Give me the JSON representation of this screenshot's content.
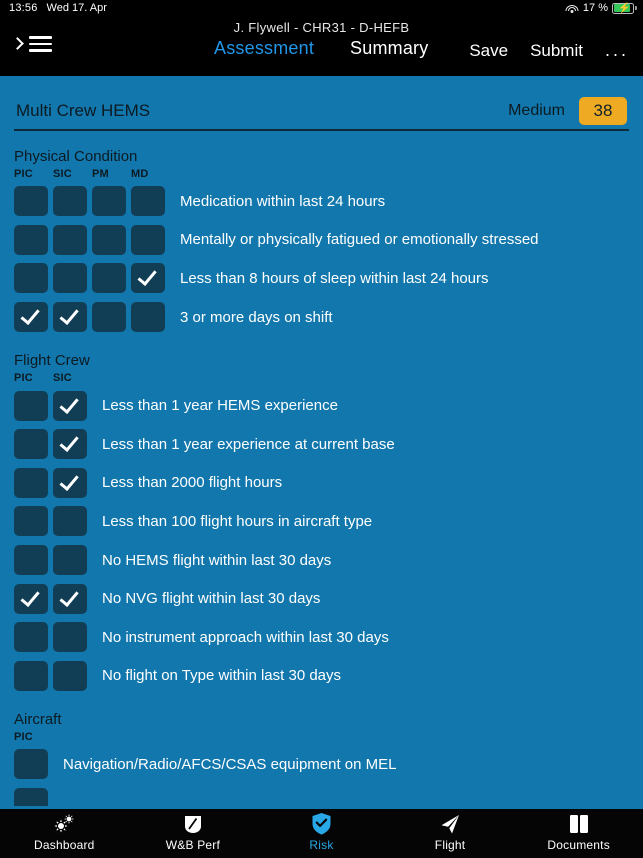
{
  "statusbar": {
    "time": "13:56",
    "date": "Wed 17. Apr",
    "wifi_icon": "wifi-icon",
    "battery_percent": "17 %",
    "battery_icon": "battery-charging-icon"
  },
  "navbar": {
    "crew_line": "J. Flywell  -  CHR31  -  D-HEFB",
    "menu_icon": "hamburger-icon",
    "expand_icon": "chevron-right-icon",
    "tabs": [
      {
        "label": "Assessment",
        "active": true
      },
      {
        "label": "Summary",
        "active": false
      }
    ],
    "actions": [
      {
        "label": "Save"
      },
      {
        "label": "Submit"
      },
      {
        "label": "..."
      }
    ]
  },
  "header": {
    "title": "Multi Crew HEMS",
    "risk_level": "Medium",
    "risk_score": "38",
    "risk_badge_color": "#eeaa22"
  },
  "sections": [
    {
      "title": "Physical Condition",
      "columns": [
        "PIC",
        "SIC",
        "PM",
        "MD"
      ],
      "rows": [
        {
          "label": "Medication within last 24 hours",
          "checks": [
            false,
            false,
            false,
            false
          ]
        },
        {
          "label": "Mentally or physically fatigued or emotionally stressed",
          "checks": [
            false,
            false,
            false,
            false
          ]
        },
        {
          "label": "Less than 8 hours of sleep within last 24 hours",
          "checks": [
            false,
            false,
            false,
            true
          ]
        },
        {
          "label": "3 or more days on shift",
          "checks": [
            true,
            true,
            false,
            false
          ]
        }
      ]
    },
    {
      "title": "Flight Crew",
      "columns": [
        "PIC",
        "SIC"
      ],
      "rows": [
        {
          "label": "Less than 1 year HEMS experience",
          "checks": [
            false,
            true
          ]
        },
        {
          "label": "Less than 1 year experience at current base",
          "checks": [
            false,
            true
          ]
        },
        {
          "label": "Less than 2000 flight hours",
          "checks": [
            false,
            true
          ]
        },
        {
          "label": "Less than 100 flight hours in aircraft type",
          "checks": [
            false,
            false
          ]
        },
        {
          "label": "No HEMS flight within last 30 days",
          "checks": [
            false,
            false
          ]
        },
        {
          "label": "No NVG flight within last 30 days",
          "checks": [
            true,
            true
          ]
        },
        {
          "label": "No instrument approach within last 30 days",
          "checks": [
            false,
            false
          ]
        },
        {
          "label": "No flight on Type within last 30 days",
          "checks": [
            false,
            false
          ]
        }
      ]
    },
    {
      "title": "Aircraft",
      "columns": [
        "PIC"
      ],
      "rows": [
        {
          "label": "Navigation/Radio/AFCS/CSAS equipment on MEL",
          "checks": [
            false
          ]
        },
        {
          "label": "",
          "checks": [
            false
          ]
        }
      ]
    }
  ],
  "tabbar": {
    "items": [
      {
        "label": "Dashboard",
        "icon": "gears-icon",
        "active": false
      },
      {
        "label": "W&B Perf",
        "icon": "balance-icon",
        "active": false
      },
      {
        "label": "Risk",
        "icon": "shield-check-icon",
        "active": true
      },
      {
        "label": "Flight",
        "icon": "paper-plane-icon",
        "active": false
      },
      {
        "label": "Documents",
        "icon": "book-icon",
        "active": false
      }
    ],
    "active_color": "#29a8e8"
  }
}
